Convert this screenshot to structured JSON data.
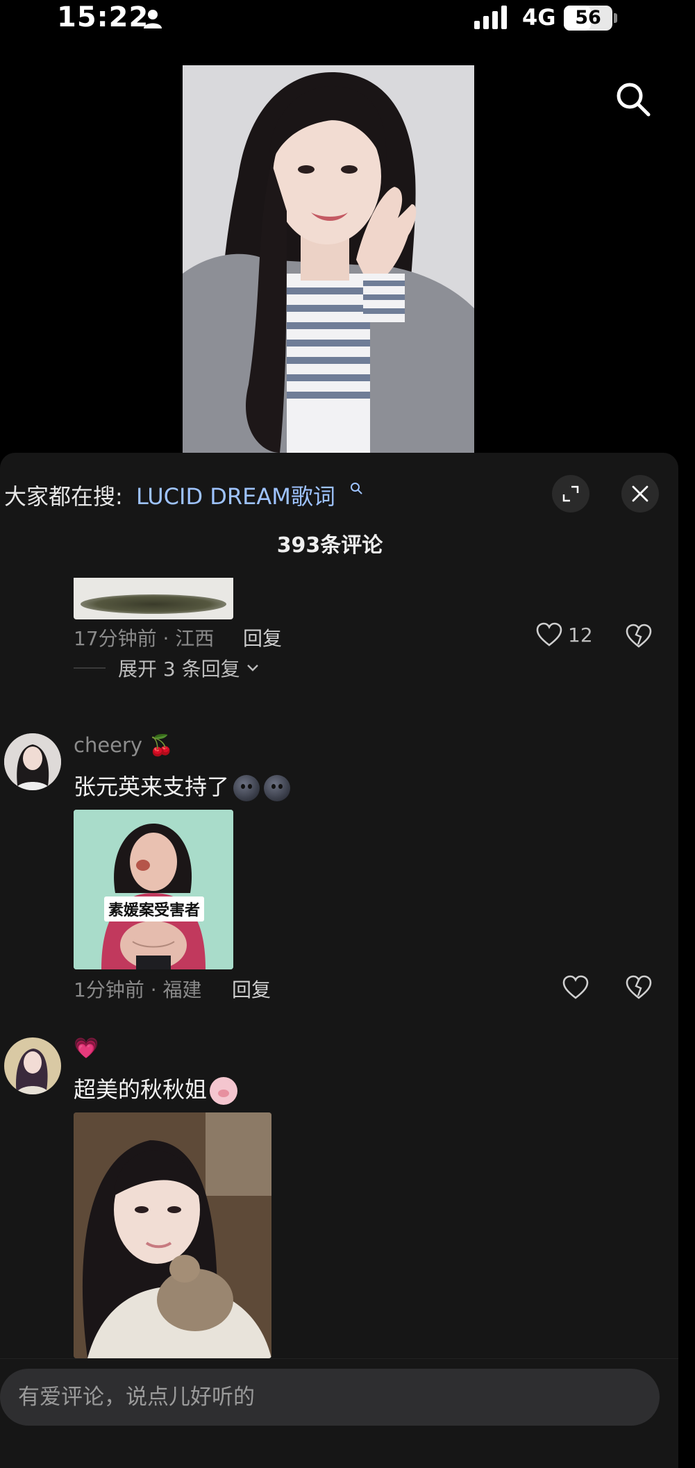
{
  "status_bar": {
    "time": "15:22",
    "network": "4G",
    "battery": "56",
    "battery_level": 0.56
  },
  "video": {
    "search_icon": "search-icon"
  },
  "panel": {
    "trending_prefix": "大家都在搜:",
    "trending_keyword": "LUCID DREAM歌词",
    "comment_count": "393条评论",
    "icons": {
      "expand": "expand-icon",
      "close": "close-icon"
    }
  },
  "comments": [
    {
      "time_location": "17分钟前 · 江西",
      "reply_label": "回复",
      "likes": "12",
      "expand_replies": "展开 3 条回复"
    },
    {
      "username": "cheery 🍒",
      "text": "张元英来支持了",
      "time_location": "1分钟前 · 福建",
      "reply_label": "回复",
      "image_label": "素媛案受害者"
    },
    {
      "username": "💗",
      "text": "超美的秋秋姐"
    }
  ],
  "input": {
    "placeholder": "有爱评论，说点儿好听的"
  },
  "colors": {
    "panel_bg": "#161616",
    "link_blue": "#9ec3ff",
    "muted_text": "#8a8a8a"
  }
}
